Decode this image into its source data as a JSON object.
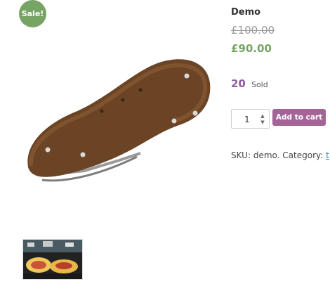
{
  "gallery": {
    "sale_badge": "Sale!",
    "main_image": "brown-leather-bike-saddle",
    "thumbnail": "food-platter-photo"
  },
  "product": {
    "title": "Demo",
    "regular_price": "£100.00",
    "sale_price": "£90.00",
    "sold_count": "20",
    "sold_label": "Sold",
    "quantity": "1",
    "add_to_cart_label": "Add to cart",
    "sku_label": "SKU:",
    "sku_value": "demo.",
    "category_label": "Category:",
    "category_link": "t"
  },
  "colors": {
    "sale_badge": "#77a464",
    "sale_price": "#77a464",
    "sold_count": "#8e5e9e",
    "add_to_cart": "#a46497",
    "link": "#1f8ac0"
  }
}
